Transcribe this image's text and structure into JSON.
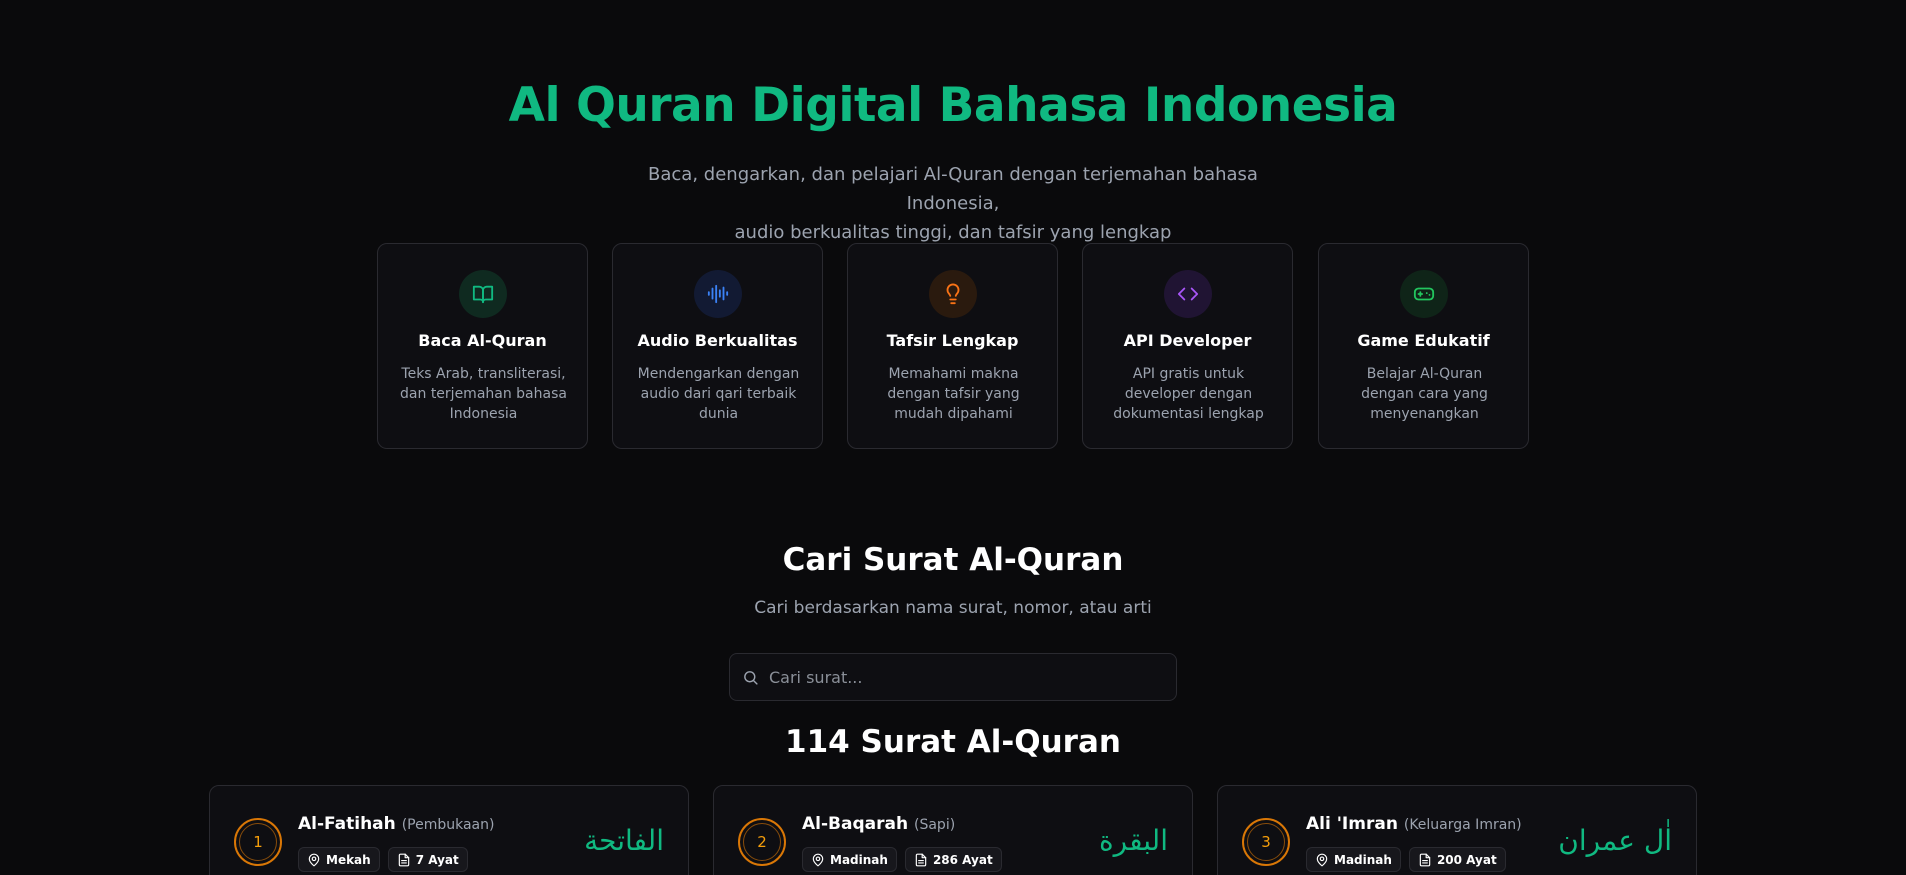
{
  "hero": {
    "title": "Al Quran Digital Bahasa Indonesia",
    "subtitle_line1": "Baca, dengarkan, dan pelajari Al-Quran dengan terjemahan bahasa Indonesia,",
    "subtitle_line2": "audio berkualitas tinggi, dan tafsir yang lengkap"
  },
  "features": [
    {
      "title": "Baca Al-Quran",
      "desc": "Teks Arab, transliterasi, dan terjemahan bahasa Indonesia",
      "icon": "book-open-icon",
      "color": "#10b981"
    },
    {
      "title": "Audio Berkualitas",
      "desc": "Mendengarkan dengan audio dari qari terbaik dunia",
      "icon": "audio-lines-icon",
      "color": "#3b82f6"
    },
    {
      "title": "Tafsir Lengkap",
      "desc": "Memahami makna dengan tafsir yang mudah dipahami",
      "icon": "lightbulb-icon",
      "color": "#f97316"
    },
    {
      "title": "API Developer",
      "desc": "API gratis untuk developer dengan dokumentasi lengkap",
      "icon": "code-icon",
      "color": "#a855f7"
    },
    {
      "title": "Game Edukatif",
      "desc": "Belajar Al-Quran dengan cara yang menyenangkan",
      "icon": "gamepad-icon",
      "color": "#22c55e"
    }
  ],
  "search": {
    "title": "Cari Surat Al-Quran",
    "subtitle": "Cari berdasarkan nama surat, nomor, atau arti",
    "placeholder": "Cari surat..."
  },
  "list": {
    "title": "114 Surat Al-Quran"
  },
  "surahs": [
    {
      "number": "1",
      "name": "Al-Fatihah",
      "translation": "(Pembukaan)",
      "arabic": "الفاتحة",
      "place": "Mekah",
      "ayat": "7 Ayat"
    },
    {
      "number": "2",
      "name": "Al-Baqarah",
      "translation": "(Sapi)",
      "arabic": "البقرة",
      "place": "Madinah",
      "ayat": "286 Ayat"
    },
    {
      "number": "3",
      "name": "Ali 'Imran",
      "translation": "(Keluarga Imran)",
      "arabic": "اٰل عمران",
      "place": "Madinah",
      "ayat": "200 Ayat"
    }
  ],
  "colors": {
    "accent": "#10b981",
    "number_ring": "#d97706",
    "background": "#0a0a0c"
  }
}
